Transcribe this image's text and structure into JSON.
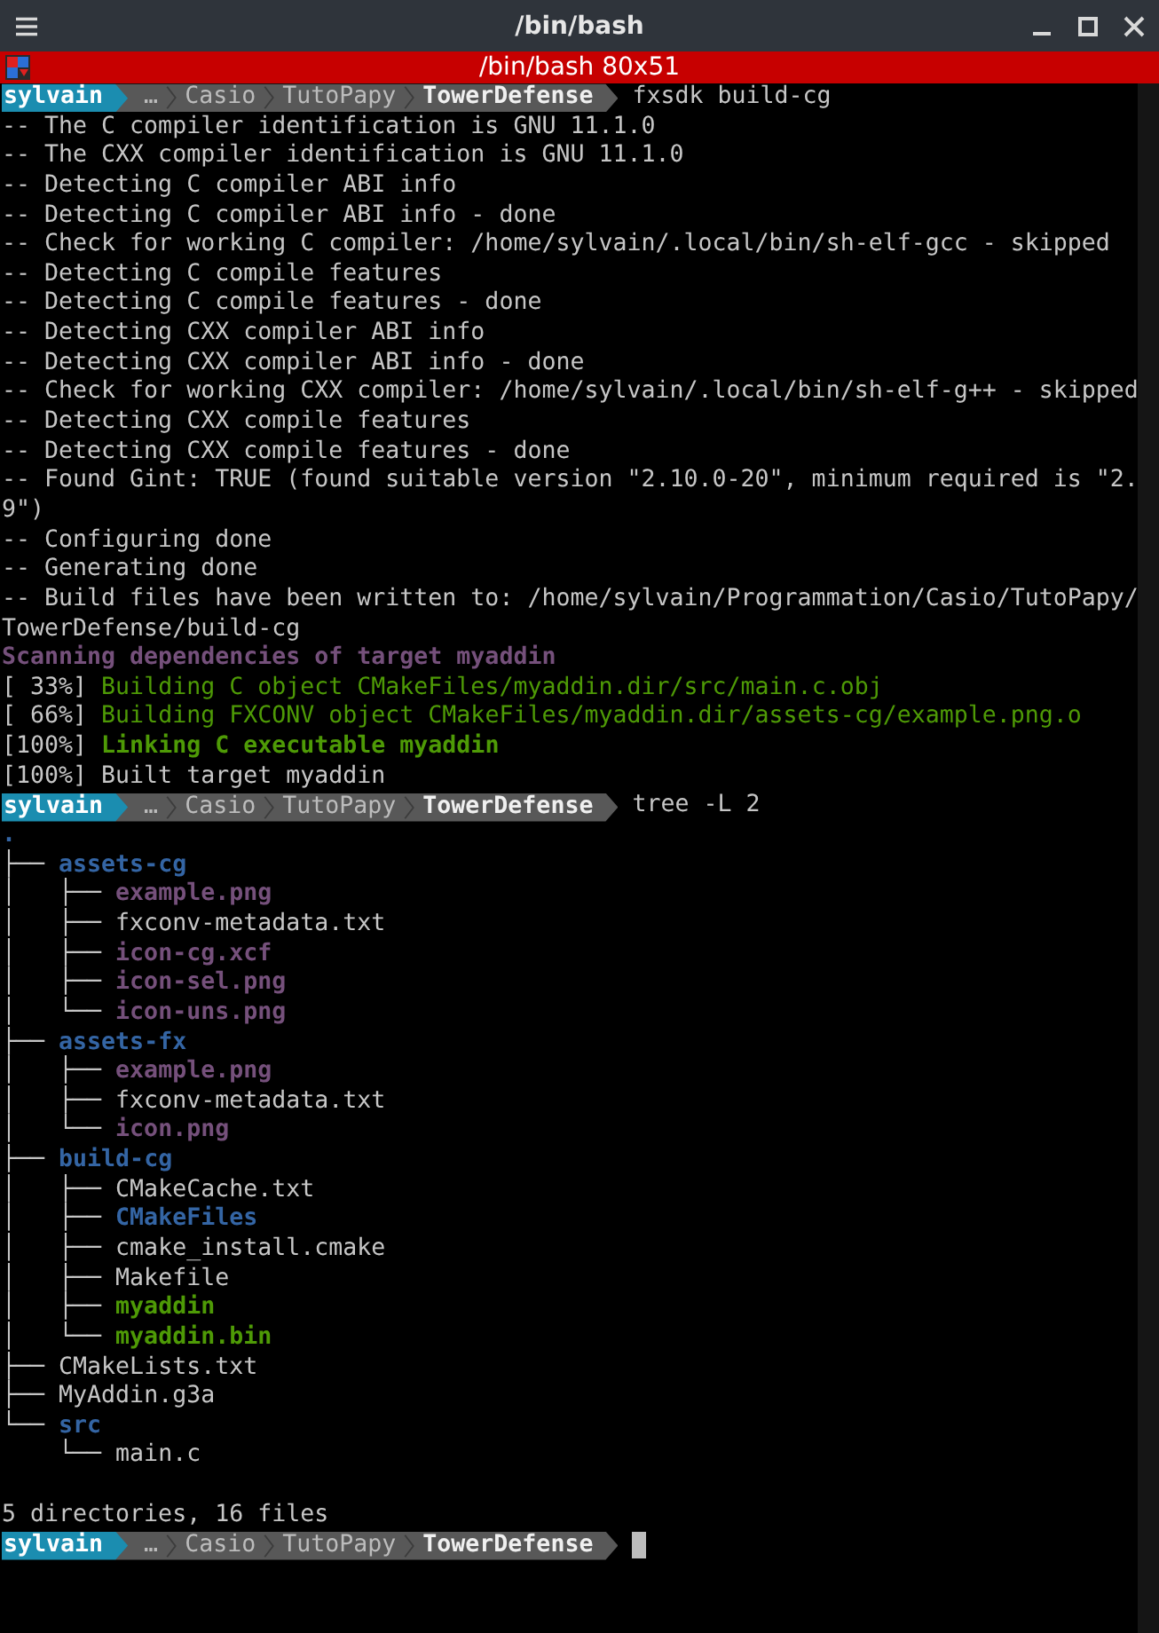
{
  "window": {
    "title": "/bin/bash"
  },
  "tab": {
    "title": "/bin/bash 80x51"
  },
  "terminal": [
    {
      "kind": "prompt",
      "user": "sylvain",
      "path": [
        "…",
        "Casio",
        "TutoPapy"
      ],
      "current": "TowerDefense",
      "command": "fxsdk build-cg"
    },
    {
      "kind": "output",
      "parts": [
        {
          "text": "-- The C compiler identification is GNU 11.1.0",
          "kind": "plain"
        }
      ]
    },
    {
      "kind": "output",
      "parts": [
        {
          "text": "-- The CXX compiler identification is GNU 11.1.0",
          "kind": "plain"
        }
      ]
    },
    {
      "kind": "output",
      "parts": [
        {
          "text": "-- Detecting C compiler ABI info",
          "kind": "plain"
        }
      ]
    },
    {
      "kind": "output",
      "parts": [
        {
          "text": "-- Detecting C compiler ABI info - done",
          "kind": "plain"
        }
      ]
    },
    {
      "kind": "output",
      "parts": [
        {
          "text": "-- Check for working C compiler: /home/sylvain/.local/bin/sh-elf-gcc - skipped",
          "kind": "plain"
        }
      ]
    },
    {
      "kind": "output",
      "parts": [
        {
          "text": "-- Detecting C compile features",
          "kind": "plain"
        }
      ]
    },
    {
      "kind": "output",
      "parts": [
        {
          "text": "-- Detecting C compile features - done",
          "kind": "plain"
        }
      ]
    },
    {
      "kind": "output",
      "parts": [
        {
          "text": "-- Detecting CXX compiler ABI info",
          "kind": "plain"
        }
      ]
    },
    {
      "kind": "output",
      "parts": [
        {
          "text": "-- Detecting CXX compiler ABI info - done",
          "kind": "plain"
        }
      ]
    },
    {
      "kind": "output",
      "parts": [
        {
          "text": "-- Check for working CXX compiler: /home/sylvain/.local/bin/sh-elf-g++ - skipped",
          "kind": "plain"
        }
      ]
    },
    {
      "kind": "output",
      "parts": [
        {
          "text": "-- Detecting CXX compile features",
          "kind": "plain"
        }
      ]
    },
    {
      "kind": "output",
      "parts": [
        {
          "text": "-- Detecting CXX compile features - done",
          "kind": "plain"
        }
      ]
    },
    {
      "kind": "output",
      "parts": [
        {
          "text": "-- Found Gint: TRUE (found suitable version \"2.10.0-20\", minimum required is \"2.",
          "kind": "plain"
        }
      ]
    },
    {
      "kind": "output",
      "parts": [
        {
          "text": "9\")",
          "kind": "plain"
        }
      ]
    },
    {
      "kind": "output",
      "parts": [
        {
          "text": "-- Configuring done",
          "kind": "plain"
        }
      ]
    },
    {
      "kind": "output",
      "parts": [
        {
          "text": "-- Generating done",
          "kind": "plain"
        }
      ]
    },
    {
      "kind": "output",
      "parts": [
        {
          "text": "-- Build files have been written to: /home/sylvain/Programmation/Casio/TutoPapy/",
          "kind": "plain"
        }
      ]
    },
    {
      "kind": "output",
      "parts": [
        {
          "text": "TowerDefense/build-cg",
          "kind": "plain"
        }
      ]
    },
    {
      "kind": "output",
      "parts": [
        {
          "text": "Scanning dependencies of target myaddin",
          "kind": "purple-bold"
        }
      ]
    },
    {
      "kind": "output",
      "parts": [
        {
          "text": "[ 33%] ",
          "kind": "plain"
        },
        {
          "text": "Building C object CMakeFiles/myaddin.dir/src/main.c.obj",
          "kind": "green"
        }
      ]
    },
    {
      "kind": "output",
      "parts": [
        {
          "text": "[ 66%] ",
          "kind": "plain"
        },
        {
          "text": "Building FXCONV object CMakeFiles/myaddin.dir/assets-cg/example.png.o",
          "kind": "green"
        }
      ]
    },
    {
      "kind": "output",
      "parts": [
        {
          "text": "[100%] ",
          "kind": "plain"
        },
        {
          "text": "Linking C executable myaddin",
          "kind": "green-bold"
        }
      ]
    },
    {
      "kind": "output",
      "parts": [
        {
          "text": "[100%] Built target myaddin",
          "kind": "plain"
        }
      ]
    },
    {
      "kind": "prompt",
      "user": "sylvain",
      "path": [
        "…",
        "Casio",
        "TutoPapy"
      ],
      "current": "TowerDefense",
      "command": "tree -L 2"
    },
    {
      "kind": "tree",
      "root": {
        "text": ".",
        "kind": "blue-bold"
      },
      "children": [
        {
          "branch": "├── ",
          "name": "assets-cg",
          "kind": "blue-bold",
          "children": [
            {
              "branch": "│   ├── ",
              "name": "example.png",
              "kind": "purple-bold"
            },
            {
              "branch": "│   ├── ",
              "name": "fxconv-metadata.txt",
              "kind": "plain"
            },
            {
              "branch": "│   ├── ",
              "name": "icon-cg.xcf",
              "kind": "purple-bold"
            },
            {
              "branch": "│   ├── ",
              "name": "icon-sel.png",
              "kind": "purple-bold"
            },
            {
              "branch": "│   └── ",
              "name": "icon-uns.png",
              "kind": "purple-bold"
            }
          ]
        },
        {
          "branch": "├── ",
          "name": "assets-fx",
          "kind": "blue-bold",
          "children": [
            {
              "branch": "│   ├── ",
              "name": "example.png",
              "kind": "purple-bold"
            },
            {
              "branch": "│   ├── ",
              "name": "fxconv-metadata.txt",
              "kind": "plain"
            },
            {
              "branch": "│   └── ",
              "name": "icon.png",
              "kind": "purple-bold"
            }
          ]
        },
        {
          "branch": "├── ",
          "name": "build-cg",
          "kind": "blue-bold",
          "children": [
            {
              "branch": "│   ├── ",
              "name": "CMakeCache.txt",
              "kind": "plain"
            },
            {
              "branch": "│   ├── ",
              "name": "CMakeFiles",
              "kind": "blue-bold"
            },
            {
              "branch": "│   ├── ",
              "name": "cmake_install.cmake",
              "kind": "plain"
            },
            {
              "branch": "│   ├── ",
              "name": "Makefile",
              "kind": "plain"
            },
            {
              "branch": "│   ├── ",
              "name": "myaddin",
              "kind": "green-bold"
            },
            {
              "branch": "│   └── ",
              "name": "myaddin.bin",
              "kind": "green-bold"
            }
          ]
        },
        {
          "branch": "├── ",
          "name": "CMakeLists.txt",
          "kind": "plain"
        },
        {
          "branch": "├── ",
          "name": "MyAddin.g3a",
          "kind": "plain"
        },
        {
          "branch": "└── ",
          "name": "src",
          "kind": "blue-bold",
          "children": [
            {
              "branch": "    └── ",
              "name": "main.c",
              "kind": "plain"
            }
          ]
        }
      ]
    },
    {
      "kind": "blank"
    },
    {
      "kind": "output",
      "parts": [
        {
          "text": "5 directories, 16 files",
          "kind": "plain"
        }
      ]
    },
    {
      "kind": "prompt",
      "user": "sylvain",
      "path": [
        "…",
        "Casio",
        "TutoPapy"
      ],
      "current": "TowerDefense"
    }
  ]
}
